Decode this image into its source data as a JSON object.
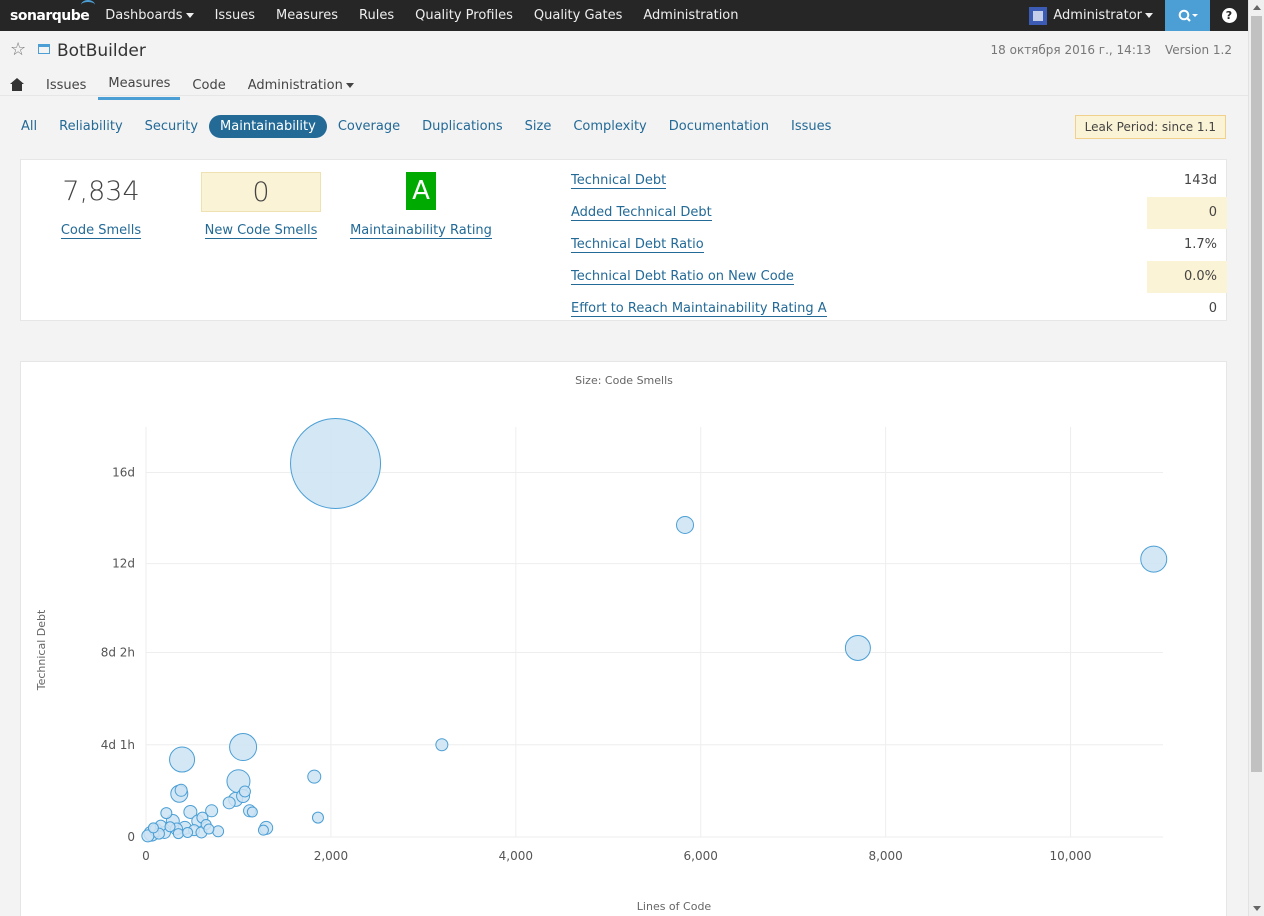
{
  "topnav": {
    "logo": "sonarqube",
    "items": [
      {
        "label": "Dashboards",
        "has_menu": true
      },
      {
        "label": "Issues"
      },
      {
        "label": "Measures"
      },
      {
        "label": "Rules"
      },
      {
        "label": "Quality Profiles"
      },
      {
        "label": "Quality Gates"
      },
      {
        "label": "Administration"
      }
    ],
    "user": "Administrator",
    "help": "?"
  },
  "project": {
    "name": "BotBuilder",
    "date": "18 октября 2016 г., 14:13",
    "version": "Version 1.2",
    "tabs": [
      {
        "label": "Issues"
      },
      {
        "label": "Measures",
        "active": true
      },
      {
        "label": "Code"
      },
      {
        "label": "Administration",
        "has_menu": true
      }
    ]
  },
  "domains": {
    "items": [
      "All",
      "Reliability",
      "Security",
      "Maintainability",
      "Coverage",
      "Duplications",
      "Size",
      "Complexity",
      "Documentation",
      "Issues"
    ],
    "active": "Maintainability",
    "leak_period": "Leak Period: since 1.1"
  },
  "summary": {
    "code_smells": {
      "value": "7,834",
      "label": "Code Smells"
    },
    "new_code_smells": {
      "value": "0",
      "label": "New Code Smells"
    },
    "maintainability_rating": {
      "value": "A",
      "label": "Maintainability Rating",
      "color": "#00aa00"
    },
    "measures": [
      {
        "label": "Technical Debt",
        "value": "143d",
        "leak": false
      },
      {
        "label": "Added Technical Debt",
        "value": "0",
        "leak": true
      },
      {
        "label": "Technical Debt Ratio",
        "value": "1.7%",
        "leak": false
      },
      {
        "label": "Technical Debt Ratio on New Code",
        "value": "0.0%",
        "leak": true
      },
      {
        "label": "Effort to Reach Maintainability Rating A",
        "value": "0",
        "leak": false
      }
    ]
  },
  "chart_data": {
    "type": "scatter",
    "title": "Size: Code Smells",
    "xlabel": "Lines of Code",
    "ylabel": "Technical Debt",
    "xlim": [
      0,
      11000
    ],
    "ylim_days": [
      0,
      18
    ],
    "x_ticks": [
      {
        "v": 0,
        "label": "0"
      },
      {
        "v": 2000,
        "label": "2,000"
      },
      {
        "v": 4000,
        "label": "4,000"
      },
      {
        "v": 6000,
        "label": "6,000"
      },
      {
        "v": 8000,
        "label": "8,000"
      },
      {
        "v": 10000,
        "label": "10,000"
      }
    ],
    "y_ticks": [
      {
        "v": 0,
        "label": "0"
      },
      {
        "v": 4.05,
        "label": "4d 1h"
      },
      {
        "v": 8.1,
        "label": "8d 2h"
      },
      {
        "v": 12,
        "label": "12d"
      },
      {
        "v": 16,
        "label": "16d"
      }
    ],
    "grid": true,
    "color": "#4b9fd5",
    "fill": "#cde3f3",
    "points": [
      {
        "x": 2050,
        "y": 16.4,
        "size": 45
      },
      {
        "x": 5830,
        "y": 13.7,
        "size": 8.5
      },
      {
        "x": 10900,
        "y": 12.2,
        "size": 13
      },
      {
        "x": 7700,
        "y": 8.3,
        "size": 12.5
      },
      {
        "x": 3200,
        "y": 4.05,
        "size": 6
      },
      {
        "x": 1050,
        "y": 3.95,
        "size": 13.5
      },
      {
        "x": 390,
        "y": 3.4,
        "size": 12.5
      },
      {
        "x": 1000,
        "y": 2.45,
        "size": 11.5
      },
      {
        "x": 1820,
        "y": 2.65,
        "size": 6.5
      },
      {
        "x": 360,
        "y": 1.9,
        "size": 8.5
      },
      {
        "x": 380,
        "y": 2.05,
        "size": 6
      },
      {
        "x": 1070,
        "y": 2.0,
        "size": 5.5
      },
      {
        "x": 1050,
        "y": 1.8,
        "size": 6.5
      },
      {
        "x": 970,
        "y": 1.65,
        "size": 7
      },
      {
        "x": 900,
        "y": 1.5,
        "size": 6
      },
      {
        "x": 1120,
        "y": 1.15,
        "size": 6
      },
      {
        "x": 1150,
        "y": 1.1,
        "size": 5
      },
      {
        "x": 480,
        "y": 1.1,
        "size": 6.5
      },
      {
        "x": 220,
        "y": 1.05,
        "size": 5.5
      },
      {
        "x": 710,
        "y": 1.15,
        "size": 6
      },
      {
        "x": 610,
        "y": 0.85,
        "size": 5.5
      },
      {
        "x": 1860,
        "y": 0.85,
        "size": 5.5
      },
      {
        "x": 560,
        "y": 0.7,
        "size": 6
      },
      {
        "x": 290,
        "y": 0.7,
        "size": 6.5
      },
      {
        "x": 650,
        "y": 0.55,
        "size": 5
      },
      {
        "x": 1300,
        "y": 0.4,
        "size": 6.5
      },
      {
        "x": 1270,
        "y": 0.3,
        "size": 5
      },
      {
        "x": 780,
        "y": 0.25,
        "size": 5.5
      },
      {
        "x": 420,
        "y": 0.4,
        "size": 6.5
      },
      {
        "x": 520,
        "y": 0.3,
        "size": 5.5
      },
      {
        "x": 330,
        "y": 0.35,
        "size": 6
      },
      {
        "x": 160,
        "y": 0.5,
        "size": 5.5
      },
      {
        "x": 110,
        "y": 0.3,
        "size": 6.5
      },
      {
        "x": 60,
        "y": 0.15,
        "size": 7.5
      },
      {
        "x": 20,
        "y": 0.05,
        "size": 6
      },
      {
        "x": 200,
        "y": 0.2,
        "size": 6
      },
      {
        "x": 260,
        "y": 0.45,
        "size": 5
      },
      {
        "x": 140,
        "y": 0.15,
        "size": 5.5
      },
      {
        "x": 350,
        "y": 0.15,
        "size": 5
      },
      {
        "x": 450,
        "y": 0.2,
        "size": 5
      },
      {
        "x": 80,
        "y": 0.4,
        "size": 5
      },
      {
        "x": 600,
        "y": 0.2,
        "size": 5.5
      },
      {
        "x": 680,
        "y": 0.35,
        "size": 5
      }
    ]
  },
  "colors": {
    "nav_bg": "#262626",
    "accent": "#4b9fd5",
    "link": "#236a97",
    "leak_bg": "#fbf3d5",
    "rating_a": "#00aa00"
  }
}
